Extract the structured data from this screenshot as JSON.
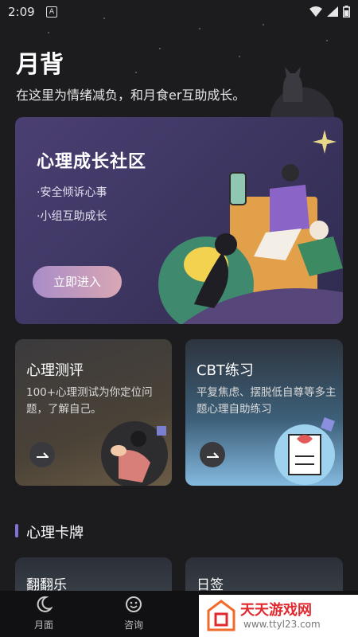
{
  "status_bar": {
    "time": "2:09",
    "notification_letter": "A"
  },
  "header": {
    "title": "月背",
    "subtitle": "在这里为情绪减负，和月食er互助成长。"
  },
  "community_card": {
    "title": "心理成长社区",
    "bullets": [
      "·安全倾诉心事",
      "·小组互助成长"
    ],
    "button_label": "立即进入"
  },
  "eval_card": {
    "title": "心理测评",
    "description": "100+心理测试为你定位问题，了解自己。"
  },
  "cbt_card": {
    "title": "CBT练习",
    "description": "平复焦虑、摆脱低自尊等多主题心理自助练习"
  },
  "section": {
    "title": "心理卡牌"
  },
  "mini_cards": [
    {
      "label": "翻翻乐"
    },
    {
      "label": "日签"
    }
  ],
  "bottom_nav": [
    {
      "label": "月面",
      "icon": "moon-icon"
    },
    {
      "label": "咨询",
      "icon": "smile-icon"
    }
  ],
  "watermark": {
    "title": "天天游戏网",
    "url": "www.ttyl23.com"
  },
  "colors": {
    "accent": "#7d74d6",
    "button_gradient_start": "#a98cc9",
    "button_gradient_end": "#d9a7b3",
    "watermark_red": "#e0282e"
  }
}
